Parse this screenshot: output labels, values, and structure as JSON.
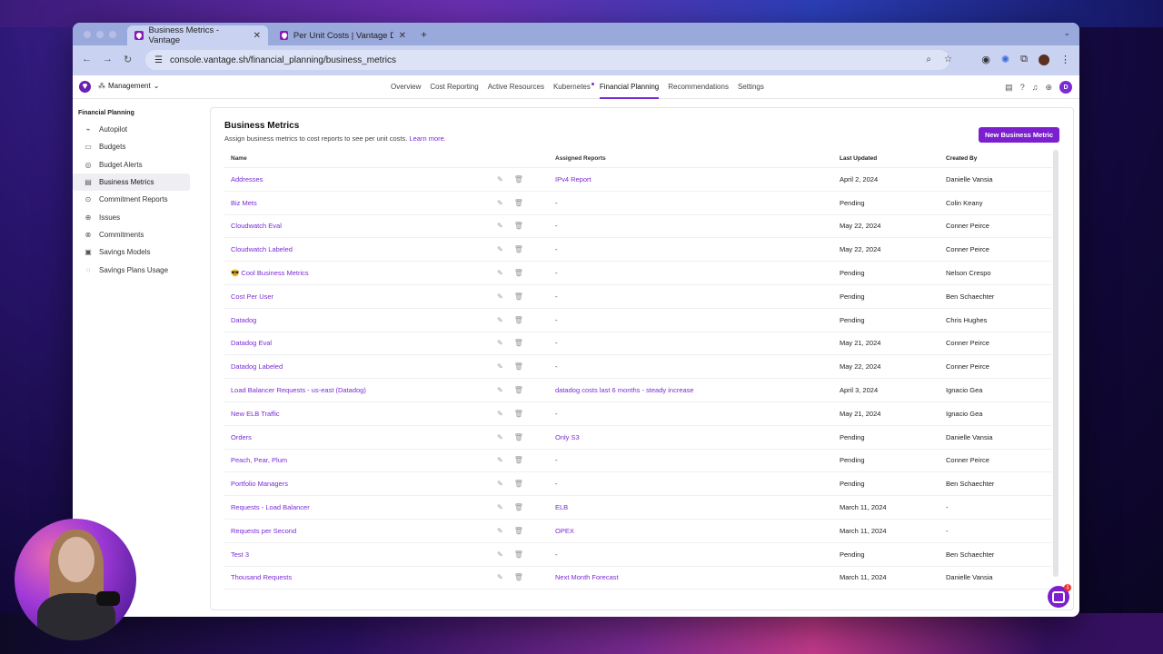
{
  "browser": {
    "tabs": [
      {
        "label": "Business Metrics - Vantage",
        "active": true
      },
      {
        "label": "Per Unit Costs | Vantage Doc",
        "active": false
      }
    ],
    "url": "console.vantage.sh/financial_planning/business_metrics"
  },
  "app": {
    "workspace": "Management",
    "nav": [
      "Overview",
      "Cost Reporting",
      "Active Resources",
      "Kubernetes",
      "Financial Planning",
      "Recommendations",
      "Settings"
    ],
    "active_nav": "Financial Planning",
    "user_initial": "D"
  },
  "sidebar": {
    "title": "Financial Planning",
    "items": [
      {
        "label": "Autopilot",
        "icon": "autopilot-icon",
        "glyph": "⌁"
      },
      {
        "label": "Budgets",
        "icon": "budget-icon",
        "glyph": "▭"
      },
      {
        "label": "Budget Alerts",
        "icon": "alert-icon",
        "glyph": "◎"
      },
      {
        "label": "Business Metrics",
        "icon": "metrics-icon",
        "glyph": "▤",
        "active": true
      },
      {
        "label": "Commitment Reports",
        "icon": "report-icon",
        "glyph": "⊙"
      },
      {
        "label": "Issues",
        "icon": "issues-icon",
        "glyph": "⊕"
      },
      {
        "label": "Commitments",
        "icon": "commitments-icon",
        "glyph": "⊗"
      },
      {
        "label": "Savings Models",
        "icon": "models-icon",
        "glyph": "▣"
      },
      {
        "label": "Savings Plans Usage",
        "icon": "usage-icon",
        "glyph": "◌"
      }
    ]
  },
  "page": {
    "title": "Business Metrics",
    "subtitle": "Assign business metrics to cost reports to see per unit costs.",
    "learn_more": "Learn more.",
    "new_button": "New Business Metric"
  },
  "table": {
    "headers": {
      "name": "Name",
      "reports": "Assigned Reports",
      "updated": "Last Updated",
      "created_by": "Created By"
    },
    "rows": [
      {
        "name": "Addresses",
        "reports": "IPv4 Report",
        "updated": "April 2, 2024",
        "created_by": "Danielle Vansia"
      },
      {
        "name": "Biz Mets",
        "reports": "-",
        "updated": "Pending",
        "created_by": "Colin Keany"
      },
      {
        "name": "Cloudwatch Eval",
        "reports": "-",
        "updated": "May 22, 2024",
        "created_by": "Conner Peirce"
      },
      {
        "name": "Cloudwatch Labeled",
        "reports": "-",
        "updated": "May 22, 2024",
        "created_by": "Conner Peirce"
      },
      {
        "name": "😎 Cool Business Metrics",
        "reports": "-",
        "updated": "Pending",
        "created_by": "Nelson Crespo"
      },
      {
        "name": "Cost Per User",
        "reports": "-",
        "updated": "Pending",
        "created_by": "Ben Schaechter"
      },
      {
        "name": "Datadog",
        "reports": "-",
        "updated": "Pending",
        "created_by": "Chris Hughes"
      },
      {
        "name": "Datadog Eval",
        "reports": "-",
        "updated": "May 21, 2024",
        "created_by": "Conner Peirce"
      },
      {
        "name": "Datadog Labeled",
        "reports": "-",
        "updated": "May 22, 2024",
        "created_by": "Conner Peirce"
      },
      {
        "name": "Load Balancer Requests - us-east (Datadog)",
        "reports": "datadog costs last 6 months - steady increase",
        "updated": "April 3, 2024",
        "created_by": "Ignacio Gea"
      },
      {
        "name": "New ELB Traffic",
        "reports": "-",
        "updated": "May 21, 2024",
        "created_by": "Ignacio Gea"
      },
      {
        "name": "Orders",
        "reports": "Only S3",
        "updated": "Pending",
        "created_by": "Danielle Vansia"
      },
      {
        "name": "Peach, Pear, Plum",
        "reports": "-",
        "updated": "Pending",
        "created_by": "Conner Peirce"
      },
      {
        "name": "Portfolio Managers",
        "reports": "-",
        "updated": "Pending",
        "created_by": "Ben Schaechter"
      },
      {
        "name": "Requests - Load Balancer",
        "reports": "ELB",
        "updated": "March 11, 2024",
        "created_by": "-"
      },
      {
        "name": "Requests per Second",
        "reports": "OPEX",
        "updated": "March 11, 2024",
        "created_by": "-"
      },
      {
        "name": "Test 3",
        "reports": "-",
        "updated": "Pending",
        "created_by": "Ben Schaechter"
      },
      {
        "name": "Thousand Requests",
        "reports": "Next Month Forecast",
        "updated": "March 11, 2024",
        "created_by": "Danielle Vansia"
      }
    ]
  },
  "chat": {
    "badge": "1"
  },
  "colors": {
    "accent": "#7b2bd6"
  }
}
